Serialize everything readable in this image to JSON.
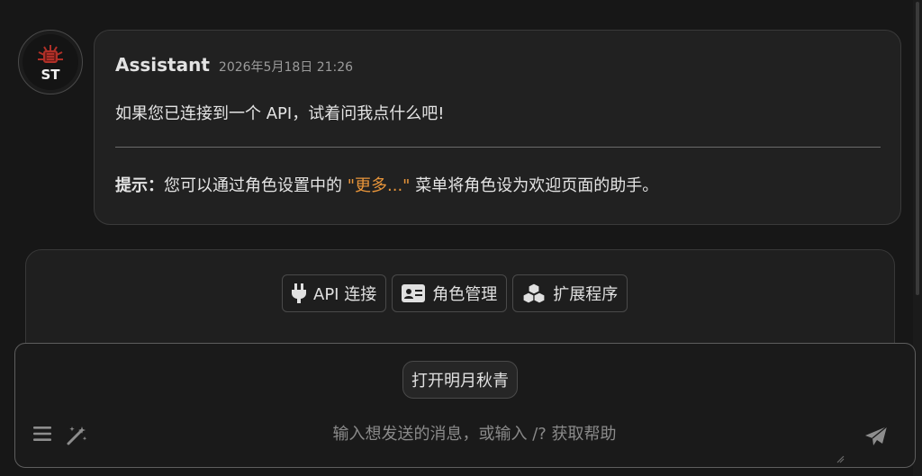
{
  "message": {
    "sender": "Assistant",
    "timestamp": "2026年5月18日 21:26",
    "line1": "如果您已连接到一个 API，试着问我点什么吧!",
    "tip_label": "提示：",
    "tip_before": "您可以通过角色设置中的 ",
    "tip_highlight": "\"更多...\"",
    "tip_after": " 菜单将角色设为欢迎页面的助手。",
    "highlight_color": "#e8953a"
  },
  "avatar": {
    "logo_text": "ST"
  },
  "shortcuts": [
    {
      "label": "API 连接",
      "icon": "plug-icon"
    },
    {
      "label": "角色管理",
      "icon": "id-card-icon"
    },
    {
      "label": "扩展程序",
      "icon": "cubes-icon"
    }
  ],
  "composer": {
    "quick_button_label": "打开明月秋青",
    "input_placeholder": "输入想发送的消息，或输入 /? 获取帮助",
    "left_icons": [
      "hamburger-menu-icon",
      "magic-wand-icon"
    ],
    "send_icon": "send-icon"
  }
}
